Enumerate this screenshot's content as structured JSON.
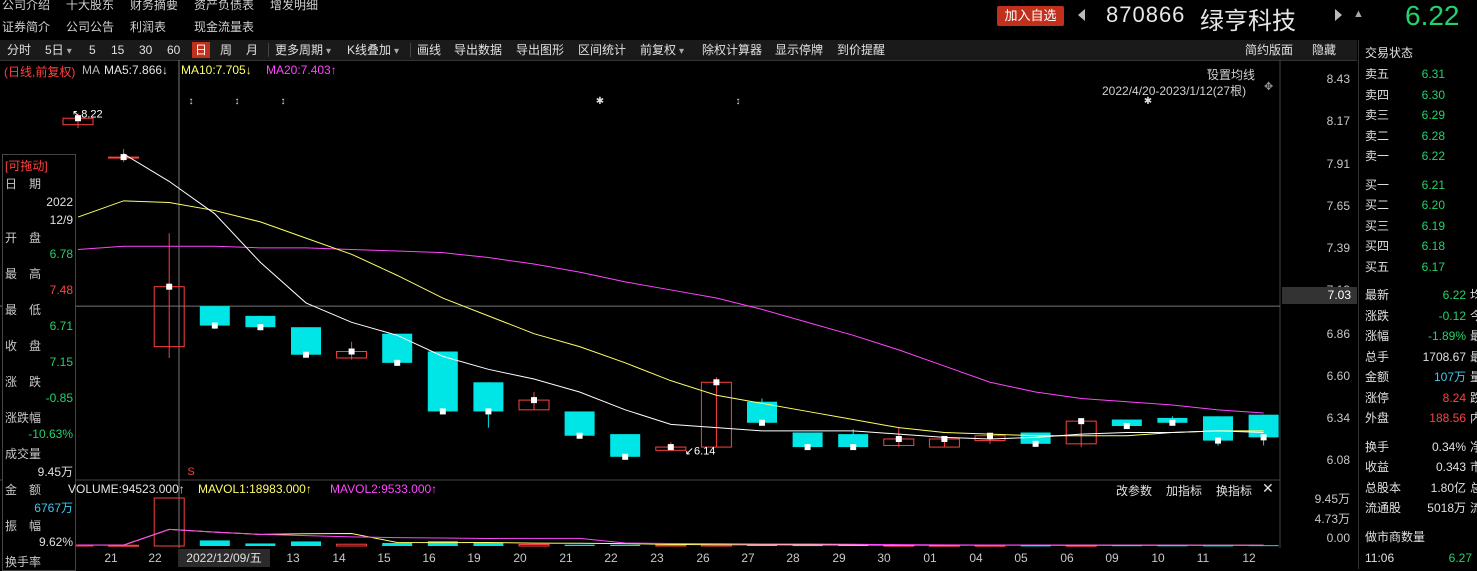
{
  "top_menu": {
    "row1": [
      "公司介绍",
      "十大股东",
      "财务摘要",
      "资产负债表",
      "增发明细"
    ],
    "row2": [
      "证券简介",
      "公司公告",
      "利润表",
      "现金流量表"
    ]
  },
  "header": {
    "add_button": "加入自选",
    "code": "870866",
    "name": "绿亨科技",
    "price": "6.22",
    "price_color": "#21d36b"
  },
  "toolbar": {
    "items": [
      "分时",
      "5日",
      "5",
      "15",
      "30",
      "60",
      "日",
      "周",
      "月",
      "更多周期",
      "K线叠加",
      "画线",
      "导出数据",
      "导出图形",
      "区间统计",
      "前复权",
      "除权计算器",
      "显示停牌",
      "到价提醒"
    ],
    "selected": "日",
    "right_items": [
      "简约版面",
      "隐藏"
    ]
  },
  "indicator_bar": {
    "mode": "(日线,前复权)",
    "ma_label": "MA",
    "ma5": "MA5:7.866↓",
    "ma10": "MA10:7.705↓",
    "ma20": "MA20:7.403↑",
    "settings": "设置均线",
    "range": "2022/4/20-2023/1/12(27根)"
  },
  "price_axis": {
    "ticks": [
      "8.43",
      "8.17",
      "7.91",
      "7.65",
      "7.39",
      "7.13",
      "6.86",
      "6.60",
      "6.34",
      "6.08"
    ],
    "crosshair_value": "7.03",
    "high_mark": "8.22",
    "low_mark": "6.14"
  },
  "data_panel": {
    "title": "[可拖动]",
    "rows": [
      {
        "label": "日　期",
        "value": "2022\n12/9"
      },
      {
        "label": "开　盘",
        "value": "6.78"
      },
      {
        "label": "最　高",
        "value": "7.48"
      },
      {
        "label": "最　低",
        "value": "6.71"
      },
      {
        "label": "收　盘",
        "value": "7.15"
      },
      {
        "label": "涨　跌",
        "value": "-0.85"
      },
      {
        "label": "涨跌幅",
        "value": "-10.63%"
      },
      {
        "label": "成交量",
        "value": "9.45万"
      },
      {
        "label": "金　额",
        "value": "6767万"
      },
      {
        "label": "振　幅",
        "value": "9.62%"
      },
      {
        "label": "换手率",
        "value": ""
      }
    ]
  },
  "volume_bar": {
    "volume": "VOLUME:94523.000↑",
    "mavol1": "MAVOL1:18983.000↑",
    "mavol2": "MAVOL2:9533.000↑",
    "buttons": [
      "改参数",
      "加指标",
      "换指标"
    ]
  },
  "volume_axis": [
    "9.45万",
    "4.73万",
    "0.00"
  ],
  "date_axis": {
    "labels": [
      "21",
      "22",
      "13",
      "14",
      "15",
      "16",
      "19",
      "20",
      "21",
      "22",
      "23",
      "26",
      "27",
      "28",
      "29",
      "30",
      "01",
      "04",
      "05",
      "06",
      "09",
      "10",
      "11",
      "12"
    ],
    "selected": "2022/12/09/五"
  },
  "order_book": {
    "title": "交易状态",
    "sells": [
      {
        "label": "卖五",
        "price": "6.31"
      },
      {
        "label": "卖四",
        "price": "6.30"
      },
      {
        "label": "卖三",
        "price": "6.29"
      },
      {
        "label": "卖二",
        "price": "6.28"
      },
      {
        "label": "卖一",
        "price": "6.22"
      }
    ],
    "buys": [
      {
        "label": "买一",
        "price": "6.21"
      },
      {
        "label": "买二",
        "price": "6.20"
      },
      {
        "label": "买三",
        "price": "6.19"
      },
      {
        "label": "买四",
        "price": "6.18"
      },
      {
        "label": "买五",
        "price": "6.17"
      }
    ]
  },
  "quote": {
    "rows": [
      {
        "label": "最新",
        "value": "6.22",
        "color": "#21d36b",
        "cut": "均"
      },
      {
        "label": "涨跌",
        "value": "-0.12",
        "color": "#21d36b",
        "cut": "今"
      },
      {
        "label": "涨幅",
        "value": "-1.89%",
        "color": "#21d36b",
        "cut": "最"
      },
      {
        "label": "总手",
        "value": "1708.67",
        "color": "#e0e0e0",
        "cut": "最"
      },
      {
        "label": "金额",
        "value": "107万",
        "color": "#3fc8f0",
        "cut": "量"
      },
      {
        "label": "涨停",
        "value": "8.24",
        "color": "#ff4040",
        "cut": "跌"
      },
      {
        "label": "外盘",
        "value": "188.56",
        "color": "#ff4040",
        "cut": "内"
      },
      {
        "label": "换手",
        "value": "0.34%",
        "color": "#e0e0e0",
        "cut": "净"
      },
      {
        "label": "收益",
        "value": "0.343",
        "color": "#e0e0e0",
        "cut": "市"
      },
      {
        "label": "总股本",
        "value": "1.80亿",
        "color": "#e0e0e0",
        "cut": "总"
      },
      {
        "label": "流通股",
        "value": "5018万",
        "color": "#e0e0e0",
        "cut": "流"
      }
    ],
    "market_maker": "做市商数量",
    "last_time": "11:06",
    "last_price": "6.27"
  },
  "chart_data": {
    "type": "candlestick",
    "dates": [
      "21",
      "22",
      "12/09",
      "12",
      "13",
      "14",
      "15",
      "16",
      "19",
      "20",
      "21",
      "22",
      "23",
      "26",
      "27",
      "28",
      "29",
      "30",
      "01",
      "03",
      "04",
      "05",
      "06",
      "09",
      "10",
      "11",
      "12"
    ],
    "candles": [
      {
        "o": 8.15,
        "c": 8.19,
        "h": 8.22,
        "l": 8.13
      },
      {
        "o": 7.95,
        "c": 7.95,
        "h": 8.0,
        "l": 7.92
      },
      {
        "o": 6.78,
        "c": 7.15,
        "h": 7.48,
        "l": 6.71
      },
      {
        "o": 7.03,
        "c": 6.91,
        "h": 7.03,
        "l": 6.89
      },
      {
        "o": 6.97,
        "c": 6.9,
        "h": 6.97,
        "l": 6.88
      },
      {
        "o": 6.9,
        "c": 6.73,
        "h": 6.9,
        "l": 6.73
      },
      {
        "o": 6.71,
        "c": 6.75,
        "h": 6.81,
        "l": 6.7
      },
      {
        "o": 6.86,
        "c": 6.68,
        "h": 6.86,
        "l": 6.67
      },
      {
        "o": 6.75,
        "c": 6.38,
        "h": 6.75,
        "l": 6.37
      },
      {
        "o": 6.56,
        "c": 6.38,
        "h": 6.56,
        "l": 6.28
      },
      {
        "o": 6.39,
        "c": 6.45,
        "h": 6.5,
        "l": 6.39
      },
      {
        "o": 6.38,
        "c": 6.23,
        "h": 6.38,
        "l": 6.22
      },
      {
        "o": 6.24,
        "c": 6.1,
        "h": 6.24,
        "l": 6.09
      },
      {
        "o": 6.14,
        "c": 6.16,
        "h": 6.19,
        "l": 6.14
      },
      {
        "o": 6.16,
        "c": 6.56,
        "h": 6.59,
        "l": 6.16
      },
      {
        "o": 6.44,
        "c": 6.31,
        "h": 6.46,
        "l": 6.3
      },
      {
        "o": 6.25,
        "c": 6.16,
        "h": 6.25,
        "l": 6.15
      },
      {
        "o": 6.24,
        "c": 6.16,
        "h": 6.27,
        "l": 6.15
      },
      {
        "o": 6.17,
        "c": 6.21,
        "h": 6.28,
        "l": 6.16
      },
      {
        "o": 6.16,
        "c": 6.21,
        "h": 6.21,
        "l": 6.16
      },
      {
        "o": 6.2,
        "c": 6.23,
        "h": 6.24,
        "l": 6.18
      },
      {
        "o": 6.25,
        "c": 6.18,
        "h": 6.25,
        "l": 6.18
      },
      {
        "o": 6.18,
        "c": 6.32,
        "h": 6.34,
        "l": 6.16
      },
      {
        "o": 6.33,
        "c": 6.29,
        "h": 6.33,
        "l": 6.29
      },
      {
        "o": 6.34,
        "c": 6.31,
        "h": 6.35,
        "l": 6.3
      },
      {
        "o": 6.35,
        "c": 6.2,
        "h": 6.35,
        "l": 6.17
      },
      {
        "o": 6.36,
        "c": 6.22,
        "h": 6.36,
        "l": 6.17
      }
    ],
    "ma5": [
      null,
      7.97,
      7.8,
      7.6,
      7.3,
      7.05,
      6.93,
      6.85,
      6.72,
      6.64,
      6.58,
      6.5,
      6.39,
      6.3,
      6.28,
      6.26,
      6.26,
      6.26,
      6.24,
      6.22,
      6.21,
      6.22,
      6.24,
      6.25,
      6.25,
      6.26,
      6.25
    ],
    "ma10": [
      7.58,
      7.68,
      7.67,
      7.62,
      7.55,
      7.45,
      7.35,
      7.22,
      7.08,
      6.97,
      6.86,
      6.78,
      6.68,
      6.57,
      6.48,
      6.43,
      6.38,
      6.33,
      6.28,
      6.25,
      6.24,
      6.23,
      6.23,
      6.23,
      6.25,
      6.26,
      6.26
    ],
    "ma20": [
      7.38,
      7.4,
      7.4,
      7.4,
      7.39,
      7.39,
      7.38,
      7.37,
      7.36,
      7.33,
      7.29,
      7.24,
      7.18,
      7.13,
      7.08,
      7.01,
      6.93,
      6.85,
      6.76,
      6.66,
      6.56,
      6.5,
      6.46,
      6.44,
      6.42,
      6.39,
      6.37
    ],
    "volume": [
      2000,
      1500,
      94523,
      11000,
      5000,
      9000,
      3500,
      6000,
      9500,
      6500,
      3000,
      2500,
      2500,
      2000,
      2600,
      2200,
      1800,
      2000,
      1700,
      1500,
      1500,
      1200,
      1500,
      1600,
      1400,
      1200,
      1700
    ],
    "ylim": [
      6.0,
      8.5
    ],
    "volume_max": 94523
  }
}
